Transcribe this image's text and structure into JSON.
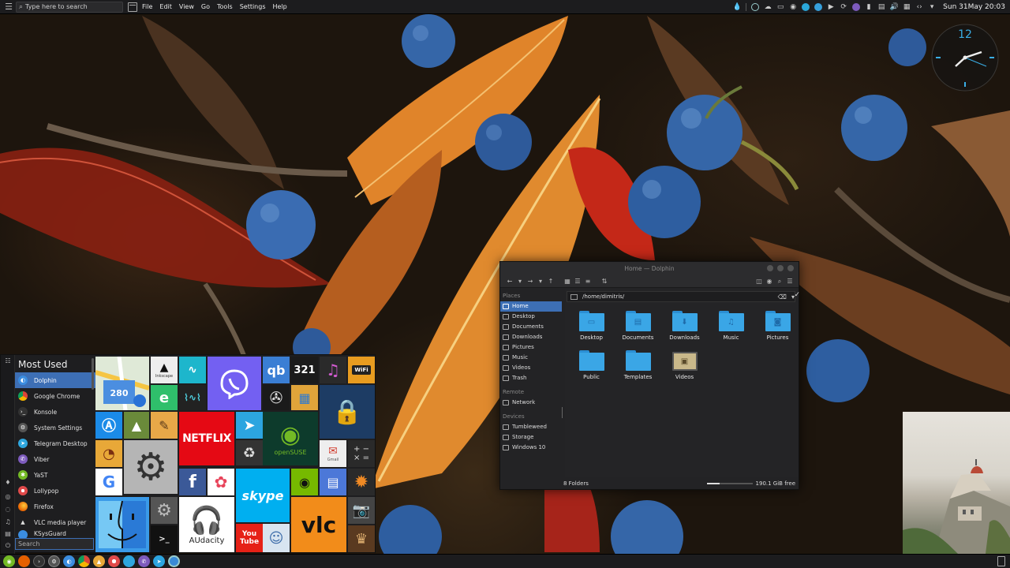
{
  "top_panel": {
    "search_placeholder": "Type here to search",
    "menu": [
      "File",
      "Edit",
      "View",
      "Go",
      "Tools",
      "Settings",
      "Help"
    ],
    "clock": "Sun 31May 20:03"
  },
  "clock_widget": {
    "number": "12"
  },
  "dolphin": {
    "title": "Home — Dolphin",
    "places_header": "Places",
    "places": [
      "Home",
      "Desktop",
      "Documents",
      "Downloads",
      "Pictures",
      "Music",
      "Videos",
      "Trash"
    ],
    "remote_header": "Remote",
    "remote": [
      "Network"
    ],
    "devices_header": "Devices",
    "devices": [
      "Tumbleweed",
      "Storage",
      "Windows 10"
    ],
    "path": "/home/dimitris/",
    "files": [
      "Desktop",
      "Documents",
      "Downloads",
      "Music",
      "Pictures",
      "Public",
      "Templates",
      "Videos"
    ],
    "status_left": "8 Folders",
    "status_free": "190.1 GiB free",
    "free_fraction": 0.28
  },
  "start_menu": {
    "title": "Most Used",
    "apps": [
      "Dolphin",
      "Google Chrome",
      "Konsole",
      "System Settings",
      "Telegram Desktop",
      "Viber",
      "YaST",
      "Lollypop",
      "Firefox",
      "VLC media player",
      "KSysGuard"
    ],
    "search_placeholder": "Search",
    "tile_texts": {
      "maps_badge": "280",
      "inkscape": "Inkscape",
      "qb": "qb",
      "num321": "321",
      "wifi": "WiFi",
      "netflix": "NETFLIX",
      "opensuse": "openSUSE",
      "gmail": "Gmail",
      "skype": "skype",
      "audacity": "AUdacity",
      "youtube": "You\nTube",
      "vlc": "vlc"
    }
  },
  "colors": {
    "accent": "#3d6fb5",
    "folder": "#3aa6e6",
    "panel": "#1c1c1e"
  }
}
